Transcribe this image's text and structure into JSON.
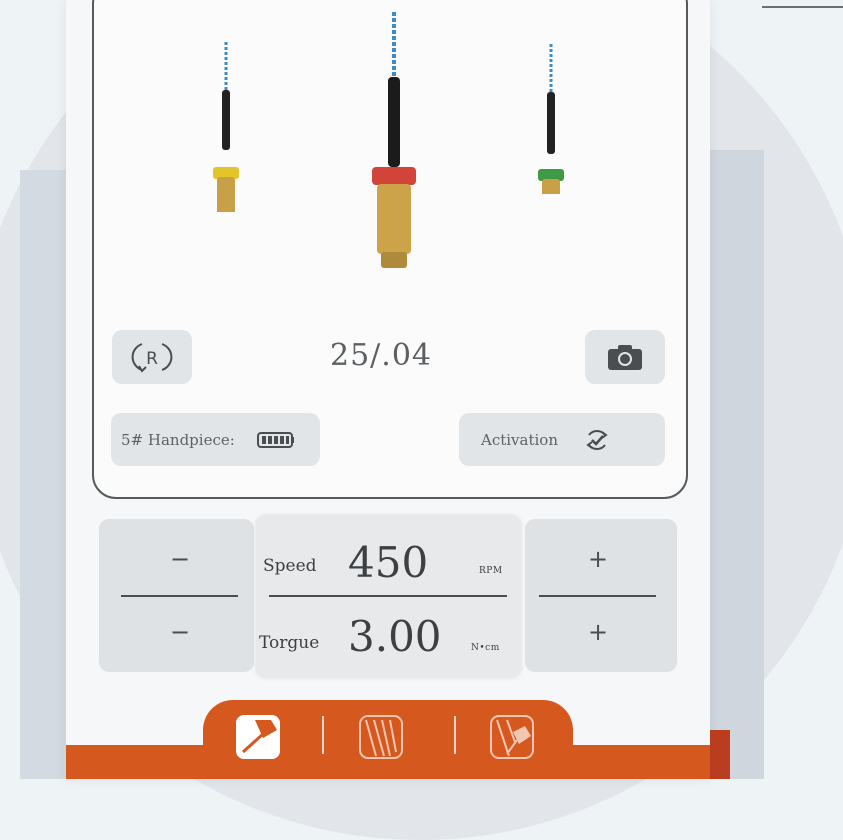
{
  "file": {
    "size": "25/.04"
  },
  "handpiece": {
    "label": "5# Handpiece:"
  },
  "activation": {
    "label": "Activation"
  },
  "speed": {
    "label": "Speed",
    "value": "450",
    "unit": "RPM",
    "minus": "−",
    "plus": "+"
  },
  "torque": {
    "label": "Torgue",
    "value": "3.00",
    "unit": "N•cm",
    "minus": "−",
    "plus": "+"
  },
  "icons": [
    "reverse-rotation-icon",
    "camera-icon",
    "battery-icon",
    "activation-check-icon",
    "single-file-mode-icon",
    "sequence-mode-icon",
    "reciprocating-mode-icon"
  ],
  "colors": {
    "accent": "#d5581f",
    "panel": "#e2e5e8",
    "file_red_ring": "#d2433a",
    "file_yellow_ring": "#e3c52a",
    "file_green_ring": "#3f9a45"
  }
}
